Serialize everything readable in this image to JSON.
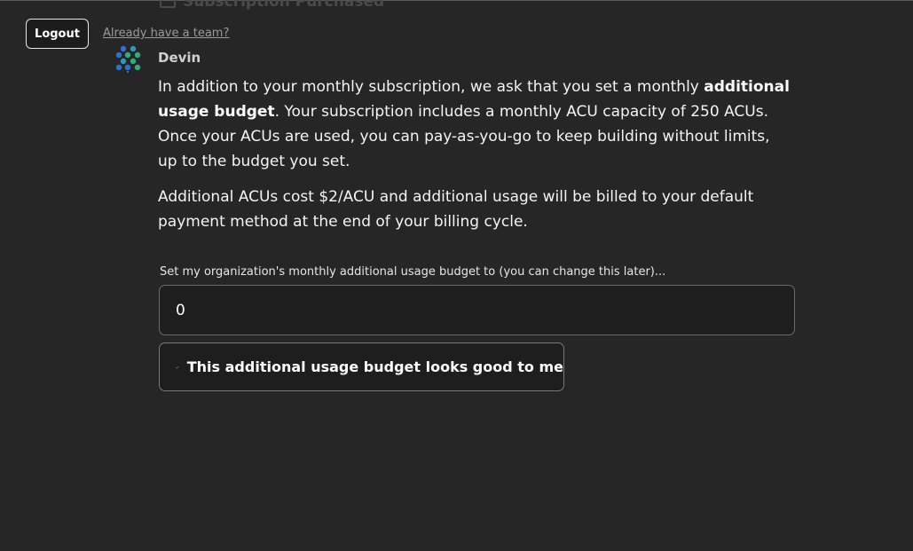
{
  "header": {
    "ghost_title": "Subscription Purchased",
    "logout_label": "Logout",
    "team_link": "Already have a team?"
  },
  "message": {
    "sender": "Devin",
    "p1_a": "In addition to your monthly subscription, we ask that you set a monthly ",
    "p1_b": "additional usage budget",
    "p1_c": ". Your subscription includes a monthly ACU capacity of 250 ACUs. Once your ACUs are used, you can pay-as-you-go to keep building without limits, up to the budget you set.",
    "p2": "Additional ACUs cost $2/ACU and additional usage will be billed to your default payment method at the end of your billing cycle."
  },
  "budget": {
    "label": "Set my organization's monthly additional usage budget to (you can change this later)...",
    "value": "0",
    "confirm_label": "This additional usage budget looks good to me"
  },
  "icons": {
    "avatar": "devin-logo-icon",
    "confirm": "check-icon",
    "ghost": "card-icon"
  },
  "colors": {
    "background": "#262626",
    "logo_blue": "#2f6fd6",
    "logo_green": "#2fae7a",
    "logo_teal": "#2a9bb8"
  }
}
